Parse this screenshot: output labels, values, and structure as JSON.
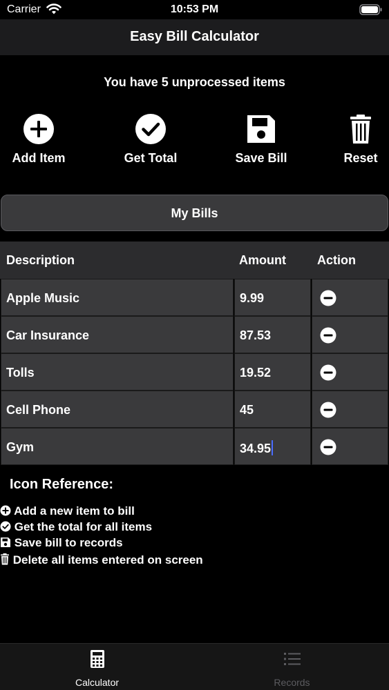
{
  "status_bar": {
    "carrier": "Carrier",
    "time": "10:53 PM"
  },
  "nav": {
    "title": "Easy Bill Calculator"
  },
  "unprocessed_text": "You have 5 unprocessed items",
  "actions": [
    {
      "label": "Add Item",
      "icon": "plus-circle-icon"
    },
    {
      "label": "Get Total",
      "icon": "check-circle-icon"
    },
    {
      "label": "Save Bill",
      "icon": "floppy-disk-icon"
    },
    {
      "label": "Reset",
      "icon": "trash-icon"
    }
  ],
  "my_bills_label": "My Bills",
  "table": {
    "headers": {
      "description": "Description",
      "amount": "Amount",
      "action": "Action"
    },
    "rows": [
      {
        "description": "Apple Music",
        "amount": "9.99"
      },
      {
        "description": "Car Insurance",
        "amount": "87.53"
      },
      {
        "description": "Tolls",
        "amount": "19.52"
      },
      {
        "description": "Cell Phone",
        "amount": "45"
      },
      {
        "description": "Gym",
        "amount": "34.95"
      }
    ]
  },
  "icon_reference": {
    "title": "Icon Reference:",
    "items": [
      {
        "text": "Add a new item to bill",
        "icon": "plus-circle-icon"
      },
      {
        "text": "Get the total for all items",
        "icon": "check-circle-icon"
      },
      {
        "text": "Save bill to records",
        "icon": "floppy-disk-icon"
      },
      {
        "text": "Delete all items entered on screen",
        "icon": "trash-icon"
      }
    ]
  },
  "tab_bar": {
    "tabs": [
      {
        "label": "Calculator",
        "icon": "calculator-icon",
        "active": true
      },
      {
        "label": "Records",
        "icon": "list-icon",
        "active": false
      }
    ]
  },
  "colors": {
    "background": "#000000",
    "nav": "#1c1c1e",
    "cell": "#3a3a3c",
    "header": "#2c2c2e",
    "caret": "#4a6cff",
    "inactive": "#5c5c60"
  }
}
